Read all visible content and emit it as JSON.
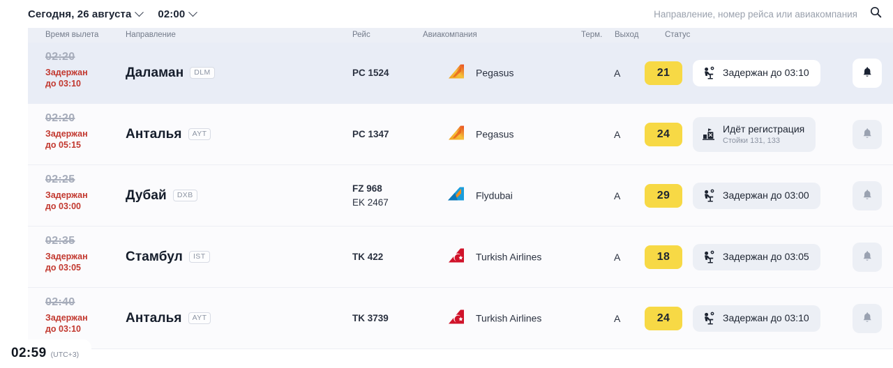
{
  "header": {
    "date_filter": "Сегодня, 26 августа",
    "time_filter": "02:00",
    "search_placeholder": "Направление, номер рейса или авиакомпания"
  },
  "columns": {
    "departure_time": "Время вылета",
    "destination": "Направление",
    "flight": "Рейс",
    "airline": "Авиакомпания",
    "terminal": "Терм.",
    "gate": "Выход",
    "status": "Статус"
  },
  "colors": {
    "gate_badge": "#f7d945",
    "delay_text": "#c2382f",
    "header_bg": "#eceff6",
    "row_highlight": "#e9edf6"
  },
  "flights": [
    {
      "scheduled_time": "02:20",
      "delay_line1": "Задержан",
      "delay_line2": "до 03:10",
      "destination": "Даламан",
      "iata": "DLM",
      "flight_primary": "PC 1524",
      "flight_secondary": "",
      "airline": "Pegasus",
      "airline_logo": "pegasus-logo",
      "terminal": "A",
      "gate": "21",
      "status_icon": "waiting-passenger-icon",
      "status_main": "Задержан до 03:10",
      "status_sub": "",
      "bell_icon": "bell-icon"
    },
    {
      "scheduled_time": "02:20",
      "delay_line1": "Задержан",
      "delay_line2": "до 05:15",
      "destination": "Анталья",
      "iata": "AYT",
      "flight_primary": "PC 1347",
      "flight_secondary": "",
      "airline": "Pegasus",
      "airline_logo": "pegasus-logo",
      "terminal": "A",
      "gate": "24",
      "status_icon": "check-in-desk-icon",
      "status_main": "Идёт регистрация",
      "status_sub": "Стойки 131, 133",
      "bell_icon": "bell-icon"
    },
    {
      "scheduled_time": "02:25",
      "delay_line1": "Задержан",
      "delay_line2": "до 03:00",
      "destination": "Дубай",
      "iata": "DXB",
      "flight_primary": "FZ 968",
      "flight_secondary": "EK 2467",
      "airline": "Flydubai",
      "airline_logo": "flydubai-logo",
      "terminal": "A",
      "gate": "29",
      "status_icon": "waiting-passenger-icon",
      "status_main": "Задержан до 03:00",
      "status_sub": "",
      "bell_icon": "bell-icon"
    },
    {
      "scheduled_time": "02:35",
      "delay_line1": "Задержан",
      "delay_line2": "до 03:05",
      "destination": "Стамбул",
      "iata": "IST",
      "flight_primary": "TK 422",
      "flight_secondary": "",
      "airline": "Turkish Airlines",
      "airline_logo": "turkish-logo",
      "terminal": "A",
      "gate": "18",
      "status_icon": "waiting-passenger-icon",
      "status_main": "Задержан до 03:05",
      "status_sub": "",
      "bell_icon": "bell-icon"
    },
    {
      "scheduled_time": "02:40",
      "delay_line1": "Задержан",
      "delay_line2": "до 03:10",
      "destination": "Анталья",
      "iata": "AYT",
      "flight_primary": "TK 3739",
      "flight_secondary": "",
      "airline": "Turkish Airlines",
      "airline_logo": "turkish-logo",
      "terminal": "A",
      "gate": "24",
      "status_icon": "waiting-passenger-icon",
      "status_main": "Задержан до 03:10",
      "status_sub": "",
      "bell_icon": "bell-icon"
    }
  ],
  "clock": {
    "time": "02:59",
    "timezone": "(UTC+3)"
  }
}
